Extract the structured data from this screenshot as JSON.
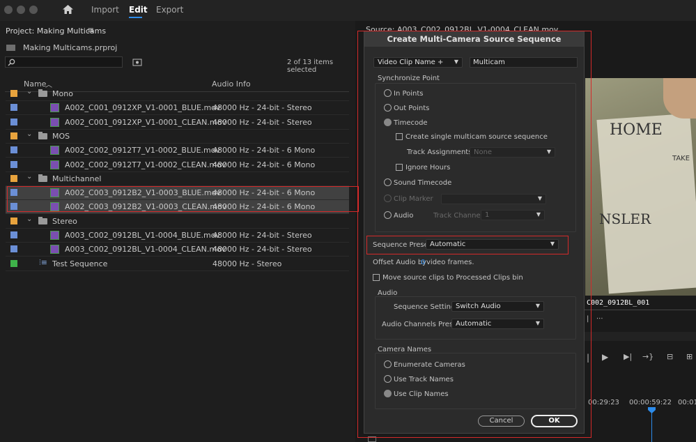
{
  "topbar": {
    "import": "Import",
    "edit": "Edit",
    "export": "Export"
  },
  "project": {
    "title": "Project: Making Multicams",
    "file": "Making Multicams.prproj",
    "selection": "2 of 13 items selected",
    "col_name": "Name",
    "col_audio": "Audio Info",
    "rows": [
      {
        "type": "folder",
        "color": "#e8a33d",
        "name": "Mono"
      },
      {
        "type": "clip",
        "color": "#6b8fd6",
        "name": "A002_C001_0912XP_V1-0001_BLUE.mov",
        "audio": "48000 Hz - 24-bit - Stereo"
      },
      {
        "type": "clip",
        "color": "#6b8fd6",
        "name": "A002_C001_0912XP_V1-0001_CLEAN.mov",
        "audio": "48000 Hz - 24-bit - Stereo"
      },
      {
        "type": "folder",
        "color": "#e8a33d",
        "name": "MOS"
      },
      {
        "type": "clip",
        "color": "#6b8fd6",
        "name": "A002_C002_0912T7_V1-0002_BLUE.mov",
        "audio": "48000 Hz - 24-bit - 6 Mono"
      },
      {
        "type": "clip",
        "color": "#6b8fd6",
        "name": "A002_C002_0912T7_V1-0002_CLEAN.mov",
        "audio": "48000 Hz - 24-bit - 6 Mono"
      },
      {
        "type": "folder",
        "color": "#e8a33d",
        "name": "Multichannel"
      },
      {
        "type": "clip",
        "color": "#6b8fd6",
        "name": "A002_C003_0912B2_V1-0003_BLUE.mov",
        "audio": "48000 Hz - 24-bit - 6 Mono",
        "selected": true
      },
      {
        "type": "clip",
        "color": "#6b8fd6",
        "name": "A002_C003_0912B2_V1-0003_CLEAN.mov",
        "audio": "48000 Hz - 24-bit - 6 Mono",
        "selected": true
      },
      {
        "type": "folder",
        "color": "#e8a33d",
        "name": "Stereo"
      },
      {
        "type": "clip",
        "color": "#6b8fd6",
        "name": "A003_C002_0912BL_V1-0004_BLUE.mov",
        "audio": "48000 Hz - 24-bit - Stereo"
      },
      {
        "type": "clip",
        "color": "#6b8fd6",
        "name": "A003_C002_0912BL_V1-0004_CLEAN.mov",
        "audio": "48000 Hz - 24-bit - Stereo"
      },
      {
        "type": "sequence",
        "color": "#3fb24a",
        "name": "Test Sequence",
        "audio": "48000 Hz - Stereo"
      }
    ]
  },
  "source": {
    "title": "Source: A003_C002_0912BL_V1-0004_CLEAN.mov",
    "clip_label": "C002_0912BL_001",
    "timecode1": "00:29:23",
    "timecode2": "00:00:59:22",
    "timecode3": "00:01",
    "slate_text1": "HOME",
    "slate_text2": "NSLER",
    "slate_text3": "TAKE"
  },
  "dialog": {
    "title": "Create Multi-Camera Source Sequence",
    "name_mode": "Video Clip Name +",
    "name_value": "Multicam",
    "sync_group": "Synchronize Point",
    "in_points": "In Points",
    "out_points": "Out Points",
    "timecode": "Timecode",
    "create_single": "Create single multicam source sequence",
    "track_assign": "Track Assignments:",
    "track_assign_value": "None",
    "ignore_hours": "Ignore Hours",
    "sound_timecode": "Sound Timecode",
    "clip_marker": "Clip Marker",
    "audio_opt": "Audio",
    "track_channel": "Track Channel",
    "track_channel_value": "1",
    "seq_preset_label": "Sequence Preset:",
    "seq_preset_value": "Automatic",
    "offset_pre": "Offset Audio by",
    "offset_value": "0",
    "offset_post": "video frames.",
    "move_source": "Move source clips to Processed Clips bin",
    "audio_group": "Audio",
    "seq_settings_label": "Sequence Settings:",
    "seq_settings_value": "Switch Audio",
    "audio_channels_label": "Audio Channels Preset:",
    "audio_channels_value": "Automatic",
    "camera_group": "Camera Names",
    "enumerate": "Enumerate Cameras",
    "use_track": "Use Track Names",
    "use_clip": "Use Clip Names",
    "cancel": "Cancel",
    "ok": "OK"
  },
  "colors": {
    "highlight": "#d42a2a",
    "accent": "#2d8ceb"
  }
}
